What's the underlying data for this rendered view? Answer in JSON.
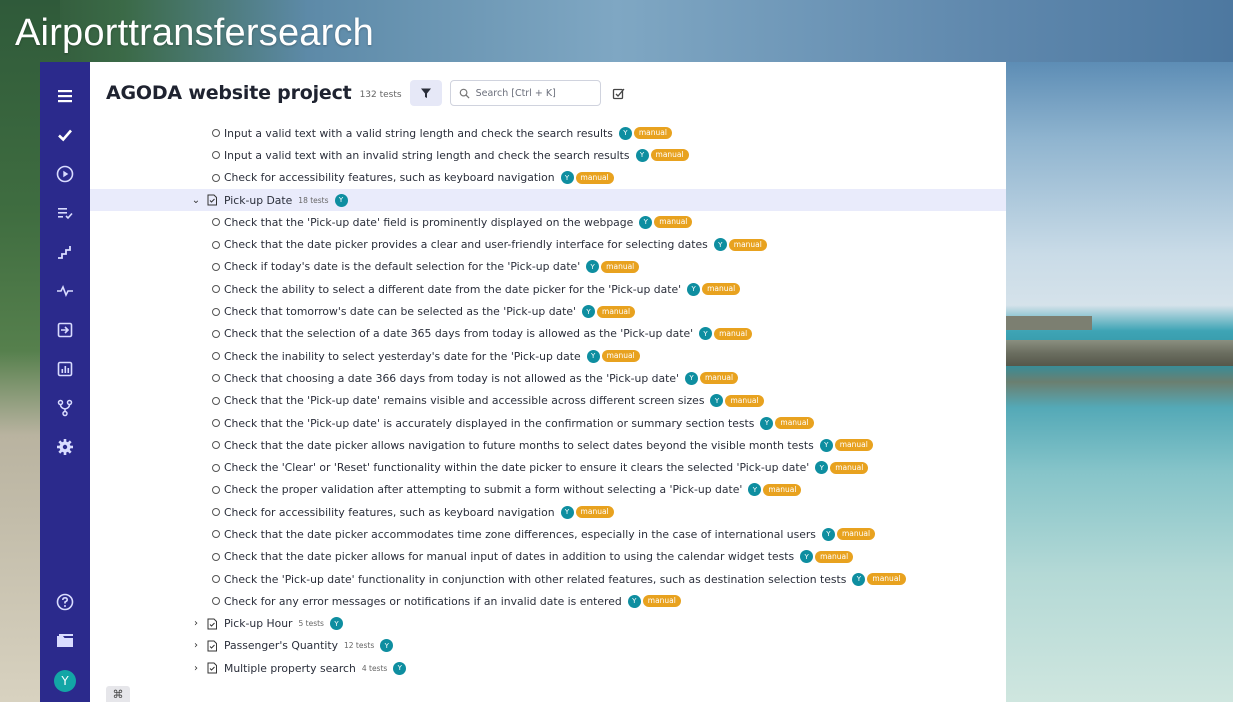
{
  "overlay_title": "Airporttransfersearch",
  "header": {
    "project_title": "AGODA website project",
    "test_count": "132 tests",
    "search_placeholder": "Search [Ctrl + K]"
  },
  "sidebar": {
    "items": [
      {
        "icon": "menu-icon"
      },
      {
        "icon": "check-icon"
      },
      {
        "icon": "play-circle-icon"
      },
      {
        "icon": "checklist-icon"
      },
      {
        "icon": "stairs-icon"
      },
      {
        "icon": "pulse-icon"
      },
      {
        "icon": "import-icon"
      },
      {
        "icon": "bar-chart-icon"
      },
      {
        "icon": "branch-icon"
      },
      {
        "icon": "gear-icon"
      }
    ],
    "bottom": [
      {
        "icon": "help-icon"
      },
      {
        "icon": "folder-icon"
      }
    ],
    "avatar_letter": "Y"
  },
  "badges": {
    "assignee": "Y",
    "manual": "manual"
  },
  "tree": {
    "pre_tests": [
      "Input a valid text with a valid string length and check the search results",
      "Input a valid text with an invalid string length and check the search results",
      "Check for accessibility features, such as keyboard navigation"
    ],
    "active_suite": {
      "name": "Pick-up Date",
      "count": "18 tests",
      "chevron": "⌄"
    },
    "active_tests": [
      "Check that the 'Pick-up date' field is prominently displayed on the webpage",
      "Check that the date picker provides a clear and user-friendly interface for selecting dates",
      "Check if today's date is the default selection for the 'Pick-up date'",
      "Check the ability to select a different date from the date picker for the 'Pick-up date'",
      "Check that tomorrow's date can be selected as the 'Pick-up date'",
      "Check that the selection of a date 365 days from today is allowed as the 'Pick-up date'",
      "Check the inability to select yesterday's date for the 'Pick-up date",
      "Check that choosing a date 366 days from today is not allowed as the 'Pick-up date'",
      "Check that the 'Pick-up date' remains visible and accessible across different screen sizes",
      "Check that the 'Pick-up date' is accurately displayed in the confirmation or summary section tests",
      "Check that the date picker allows navigation to future months to select dates beyond the visible month tests",
      "Check the 'Clear' or 'Reset' functionality within the date picker to ensure it clears the selected 'Pick-up date'",
      "Check the proper validation after attempting to submit a form without selecting a 'Pick-up date'",
      "Check for accessibility features, such as keyboard navigation",
      "Check that the date picker accommodates time zone differences, especially in the case of international users",
      "Check that the date picker allows for manual input of dates in addition to using the calendar widget tests",
      "Check the 'Pick-up date' functionality in conjunction with other related features, such as destination selection tests",
      "Check for any error messages or notifications if an invalid date is entered"
    ],
    "collapsed_suites": [
      {
        "name": "Pick-up Hour",
        "count": "5 tests",
        "chevron": "›"
      },
      {
        "name": "Passenger's Quantity",
        "count": "12 tests",
        "chevron": "›"
      },
      {
        "name": "Multiple property search",
        "count": "4 tests",
        "chevron": "›"
      }
    ]
  },
  "cmd_key": "⌘"
}
